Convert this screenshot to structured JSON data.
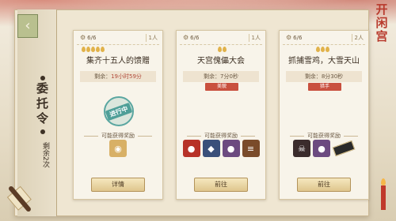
{
  "sidebar": {
    "title": "委托令",
    "remaining": "剩余2次"
  },
  "cards": [
    {
      "count": "6/6",
      "people": "1人",
      "title": "集齐十五人的馈赠",
      "remain_label": "剩余：",
      "remain_time": "19小时59分",
      "tag": "",
      "stamp": "进行中",
      "reward_label": "可能获得奖励",
      "rewards": [
        {
          "icon": "gold-ingot-icon",
          "glyph": "◉",
          "color": "gold"
        }
      ],
      "button": "详情"
    },
    {
      "count": "6/6",
      "people": "1人",
      "title": "天宫傀儡大会",
      "remain_label": "剩余：",
      "remain_time": "7分0秒",
      "tag": "美貌",
      "stamp": "",
      "reward_label": "可能获得奖励",
      "rewards": [
        {
          "icon": "red-gourd-icon",
          "glyph": "●",
          "color": "red"
        },
        {
          "icon": "blue-stone-icon",
          "glyph": "◆",
          "color": "blue"
        },
        {
          "icon": "purple-bag-icon",
          "glyph": "●",
          "color": "purple"
        },
        {
          "icon": "scroll-bundle-icon",
          "glyph": "≡",
          "color": "brown"
        }
      ],
      "button": "前往"
    },
    {
      "count": "6/6",
      "people": "2人",
      "title": "抓捕雪鸡，大雪天山",
      "remain_label": "剩余：",
      "remain_time": "8分30秒",
      "tag": "猎手",
      "stamp": "",
      "reward_label": "可能获得奖励",
      "rewards": [
        {
          "icon": "skull-mask-icon",
          "glyph": "☠",
          "color": "dark"
        },
        {
          "icon": "purple-bag-icon",
          "glyph": "●",
          "color": "purple"
        },
        {
          "icon": "talisman-icon",
          "glyph": "▭",
          "color": "plain"
        }
      ],
      "button": "前往"
    }
  ],
  "logo": [
    "开",
    "闲",
    "宫"
  ]
}
